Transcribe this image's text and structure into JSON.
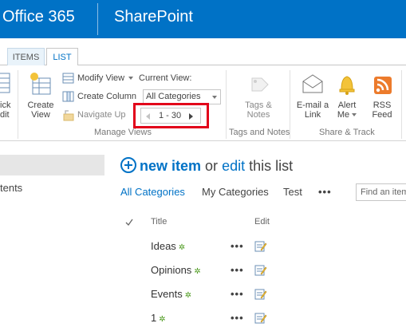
{
  "suite_bar": {
    "brand": "Office 365",
    "app": "SharePoint"
  },
  "ribbon": {
    "tabs": [
      {
        "label": "ITEMS"
      },
      {
        "label": "LIST"
      }
    ],
    "quick_edit": {
      "label_line1": "ick",
      "label_line2": "dit"
    },
    "create_view": {
      "label_line1": "Create",
      "label_line2": "View"
    },
    "modify_view": "Modify View",
    "create_column": "Create Column",
    "navigate_up": "Navigate Up",
    "current_view_label": "Current View:",
    "current_view_value": "All Categories",
    "pager_range": "1 - 30",
    "manage_views_group": "Manage Views",
    "tags_notes": {
      "label_line1": "Tags &",
      "label_line2": "Notes"
    },
    "tags_notes_group": "Tags and Notes",
    "email_link": {
      "label_line1": "E-mail a",
      "label_line2": "Link"
    },
    "alert_me": {
      "label_line1": "Alert",
      "label_line2": "Me"
    },
    "rss_feed": {
      "label_line1": "RSS",
      "label_line2": "Feed"
    },
    "share_track_group": "Share & Track"
  },
  "left_nav": {
    "item": "tents"
  },
  "list": {
    "new_item": "new item",
    "or_text": "or",
    "edit_text": "edit",
    "this_list": "this list",
    "views": [
      "All Categories",
      "My Categories",
      "Test"
    ],
    "more_views": "•••",
    "search_placeholder": "Find an item",
    "columns": {
      "title": "Title",
      "edit": "Edit"
    },
    "items": [
      {
        "title": "Ideas"
      },
      {
        "title": "Opinions"
      },
      {
        "title": "Events"
      },
      {
        "title": "1"
      }
    ],
    "new_marker": "✲",
    "row_menu": "•••"
  },
  "colors": {
    "suite_blue": "#0072c6",
    "highlight_red": "#e2001a",
    "new_green": "#4c9a1e"
  }
}
